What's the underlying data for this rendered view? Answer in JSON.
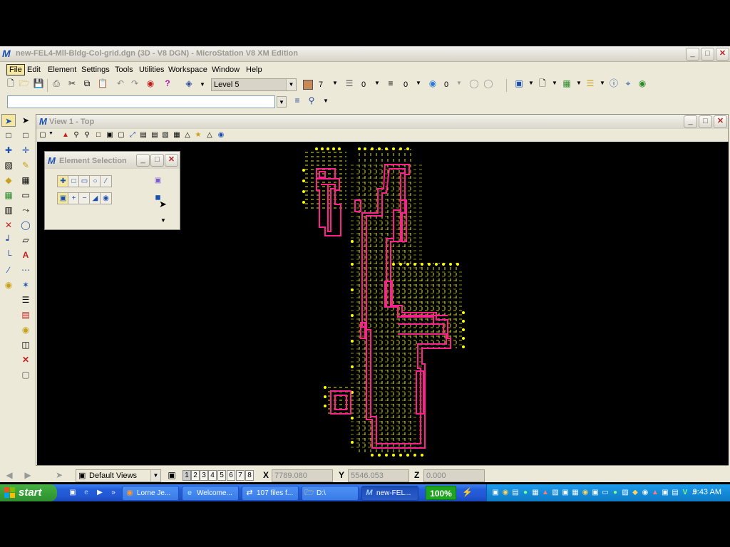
{
  "window": {
    "title": "new-FEL4-Mll-Bldg-Col-grid.dgn (3D - V8 DGN) - MicroStation V8 XM Edition",
    "app_icon": "microstation-icon"
  },
  "menu": {
    "items": [
      "File",
      "Edit",
      "Element",
      "Settings",
      "Tools",
      "Utilities",
      "Workspace",
      "Window",
      "Help"
    ],
    "active": "File"
  },
  "attributes": {
    "level": "Level 5",
    "color_value": "7",
    "color_swatch": "#c98a5a",
    "style_value": "0",
    "weight_value": "0",
    "transparency_value": "0"
  },
  "keyin": {
    "value": ""
  },
  "view1": {
    "title": "View 1 - Top"
  },
  "element_selection": {
    "title": "Element Selection"
  },
  "statusbar": {
    "saved_views": "Default Views",
    "view_numbers": [
      "1",
      "2",
      "3",
      "4",
      "5",
      "6",
      "7",
      "8"
    ],
    "x_label": "X",
    "x_value": "7789.080",
    "y_label": "Y",
    "y_value": "5546.053",
    "z_label": "Z",
    "z_value": "0.000"
  },
  "taskbar": {
    "start_label": "start",
    "tasks": [
      {
        "label": "Lorne Je...",
        "icon": "firefox-icon"
      },
      {
        "label": "Welcome...",
        "icon": "ie-icon"
      },
      {
        "label": "107 files f...",
        "icon": "transfer-icon"
      },
      {
        "label": "D:\\",
        "icon": "folder-icon"
      },
      {
        "label": "new-FEL...",
        "icon": "microstation-icon"
      }
    ],
    "zoom": "100%",
    "clock": "9:43 AM"
  },
  "colors": {
    "drawing_yellow": "#ffff00",
    "drawing_magenta": "#ff1f8f",
    "desktop_black": "#000000",
    "taskbar_blue": "#245edb"
  }
}
